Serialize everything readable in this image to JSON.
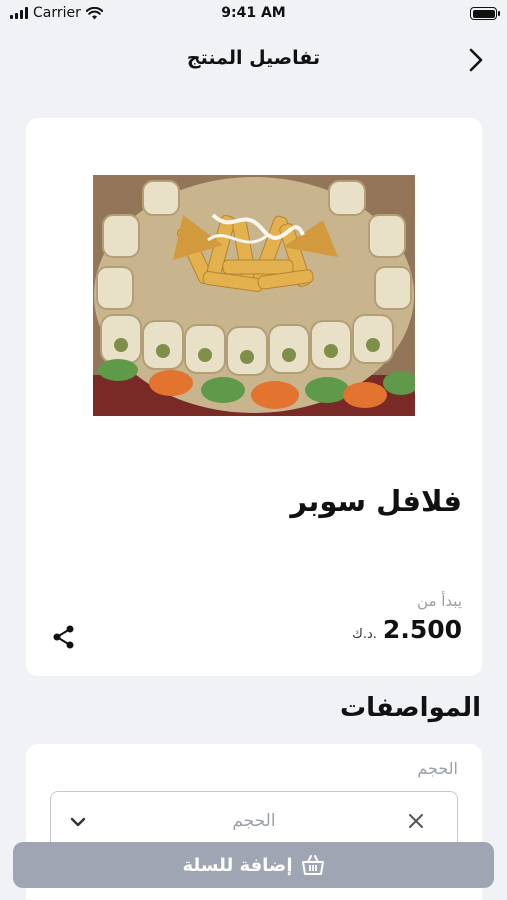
{
  "status_bar": {
    "carrier": "Carrier",
    "time": "9:41 AM"
  },
  "header": {
    "title": "تفاصيل المنتج",
    "back_icon": "chevron-right-icon"
  },
  "product": {
    "name": "فلافل سوبر",
    "price_prefix": "يبدأ من",
    "price": "2.500",
    "currency": "د.ك.",
    "share_icon": "share-icon",
    "image": "food-platter-photo"
  },
  "specs": {
    "title": "المواصفات",
    "size_label": "الحجم",
    "size_placeholder": "الحجم"
  },
  "cart_button": {
    "label": "إضافة للسلة",
    "icon": "basket-icon"
  },
  "colors": {
    "background": "#f1f2f6",
    "card": "#ffffff",
    "button": "#a0a5b4",
    "muted_text": "#9a9fa8"
  }
}
